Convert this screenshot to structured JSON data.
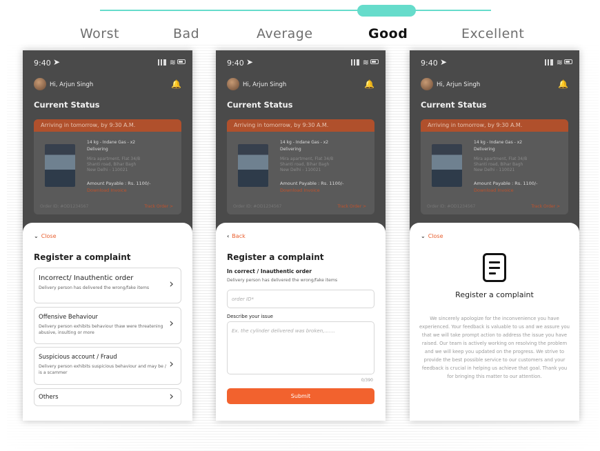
{
  "scale": {
    "labels": [
      "Worst",
      "Bad",
      "Average",
      "Good",
      "Excellent"
    ],
    "selected": "Good"
  },
  "colors": {
    "accent_teal": "#66dccb",
    "brand_orange": "#f2622e",
    "overlay": "#4a4a4a"
  },
  "phone": {
    "time": "9:40",
    "greeting": "Hi, Arjun Singh",
    "current_status": "Current Status",
    "card": {
      "header_screen1": "Arriving in tomorrow, by 9:30 A.M.",
      "header_screen2": "Arriving in tomorrow, by 9:30 A.M.",
      "header_screen3": "Arriving in tomorrow, by 9:30 A.M.",
      "product": "14 kg - Indane Gas - x2",
      "status": "Delivering",
      "address_line1": "Mira apartment, Flat 34/B",
      "address_line2": "Shanti road, Bihar Bagh",
      "address_line3": "New Delhi - 110021",
      "amount": "Amount Payable : Rs. 1100/-",
      "invoice": "Download Invoice",
      "order_id": "Order ID: #OD1234567",
      "track": "Track Order >"
    }
  },
  "screen1": {
    "close": "Close",
    "title": "Register a complaint",
    "options": [
      {
        "title": "Incorrect/ Inauthentic order",
        "desc": "Delivery person has delivered the wrong/fake items"
      },
      {
        "title": "Offensive Behaviour",
        "desc": "Delivery person exhibits behaviour thaw were threatening abusive, insulting or more"
      },
      {
        "title": "Suspicious account / Fraud",
        "desc": "Delivery person exhibits suspicious behaviour and may be / is a scammer"
      },
      {
        "title": "Others",
        "desc": ""
      }
    ]
  },
  "screen2": {
    "back": "Back",
    "title": "Register a complaint",
    "category": "In correct / Inauthentic order",
    "category_desc": "Delivery person has delivered the wrong/fake items",
    "order_placeholder": "order ID*",
    "describe_label": "Describe your issue",
    "describe_placeholder": "Ex. the cylinder delivered was broken,.......",
    "counter": "0/390",
    "submit": "Submit"
  },
  "screen3": {
    "close": "Close",
    "title": "Register a complaint",
    "message": "We sincerely apologize for the inconvenience you have experienced. Your feedback is valuable to us and we assure you that we will take prompt action to address the issue you have raised. Our team is actively working on resolving the problem and we will keep you updated on the progress. We strive to provide the best possible service to our customers and your feedback is crucial in helping us achieve that goal. Thank you for bringing this matter to our attention."
  }
}
